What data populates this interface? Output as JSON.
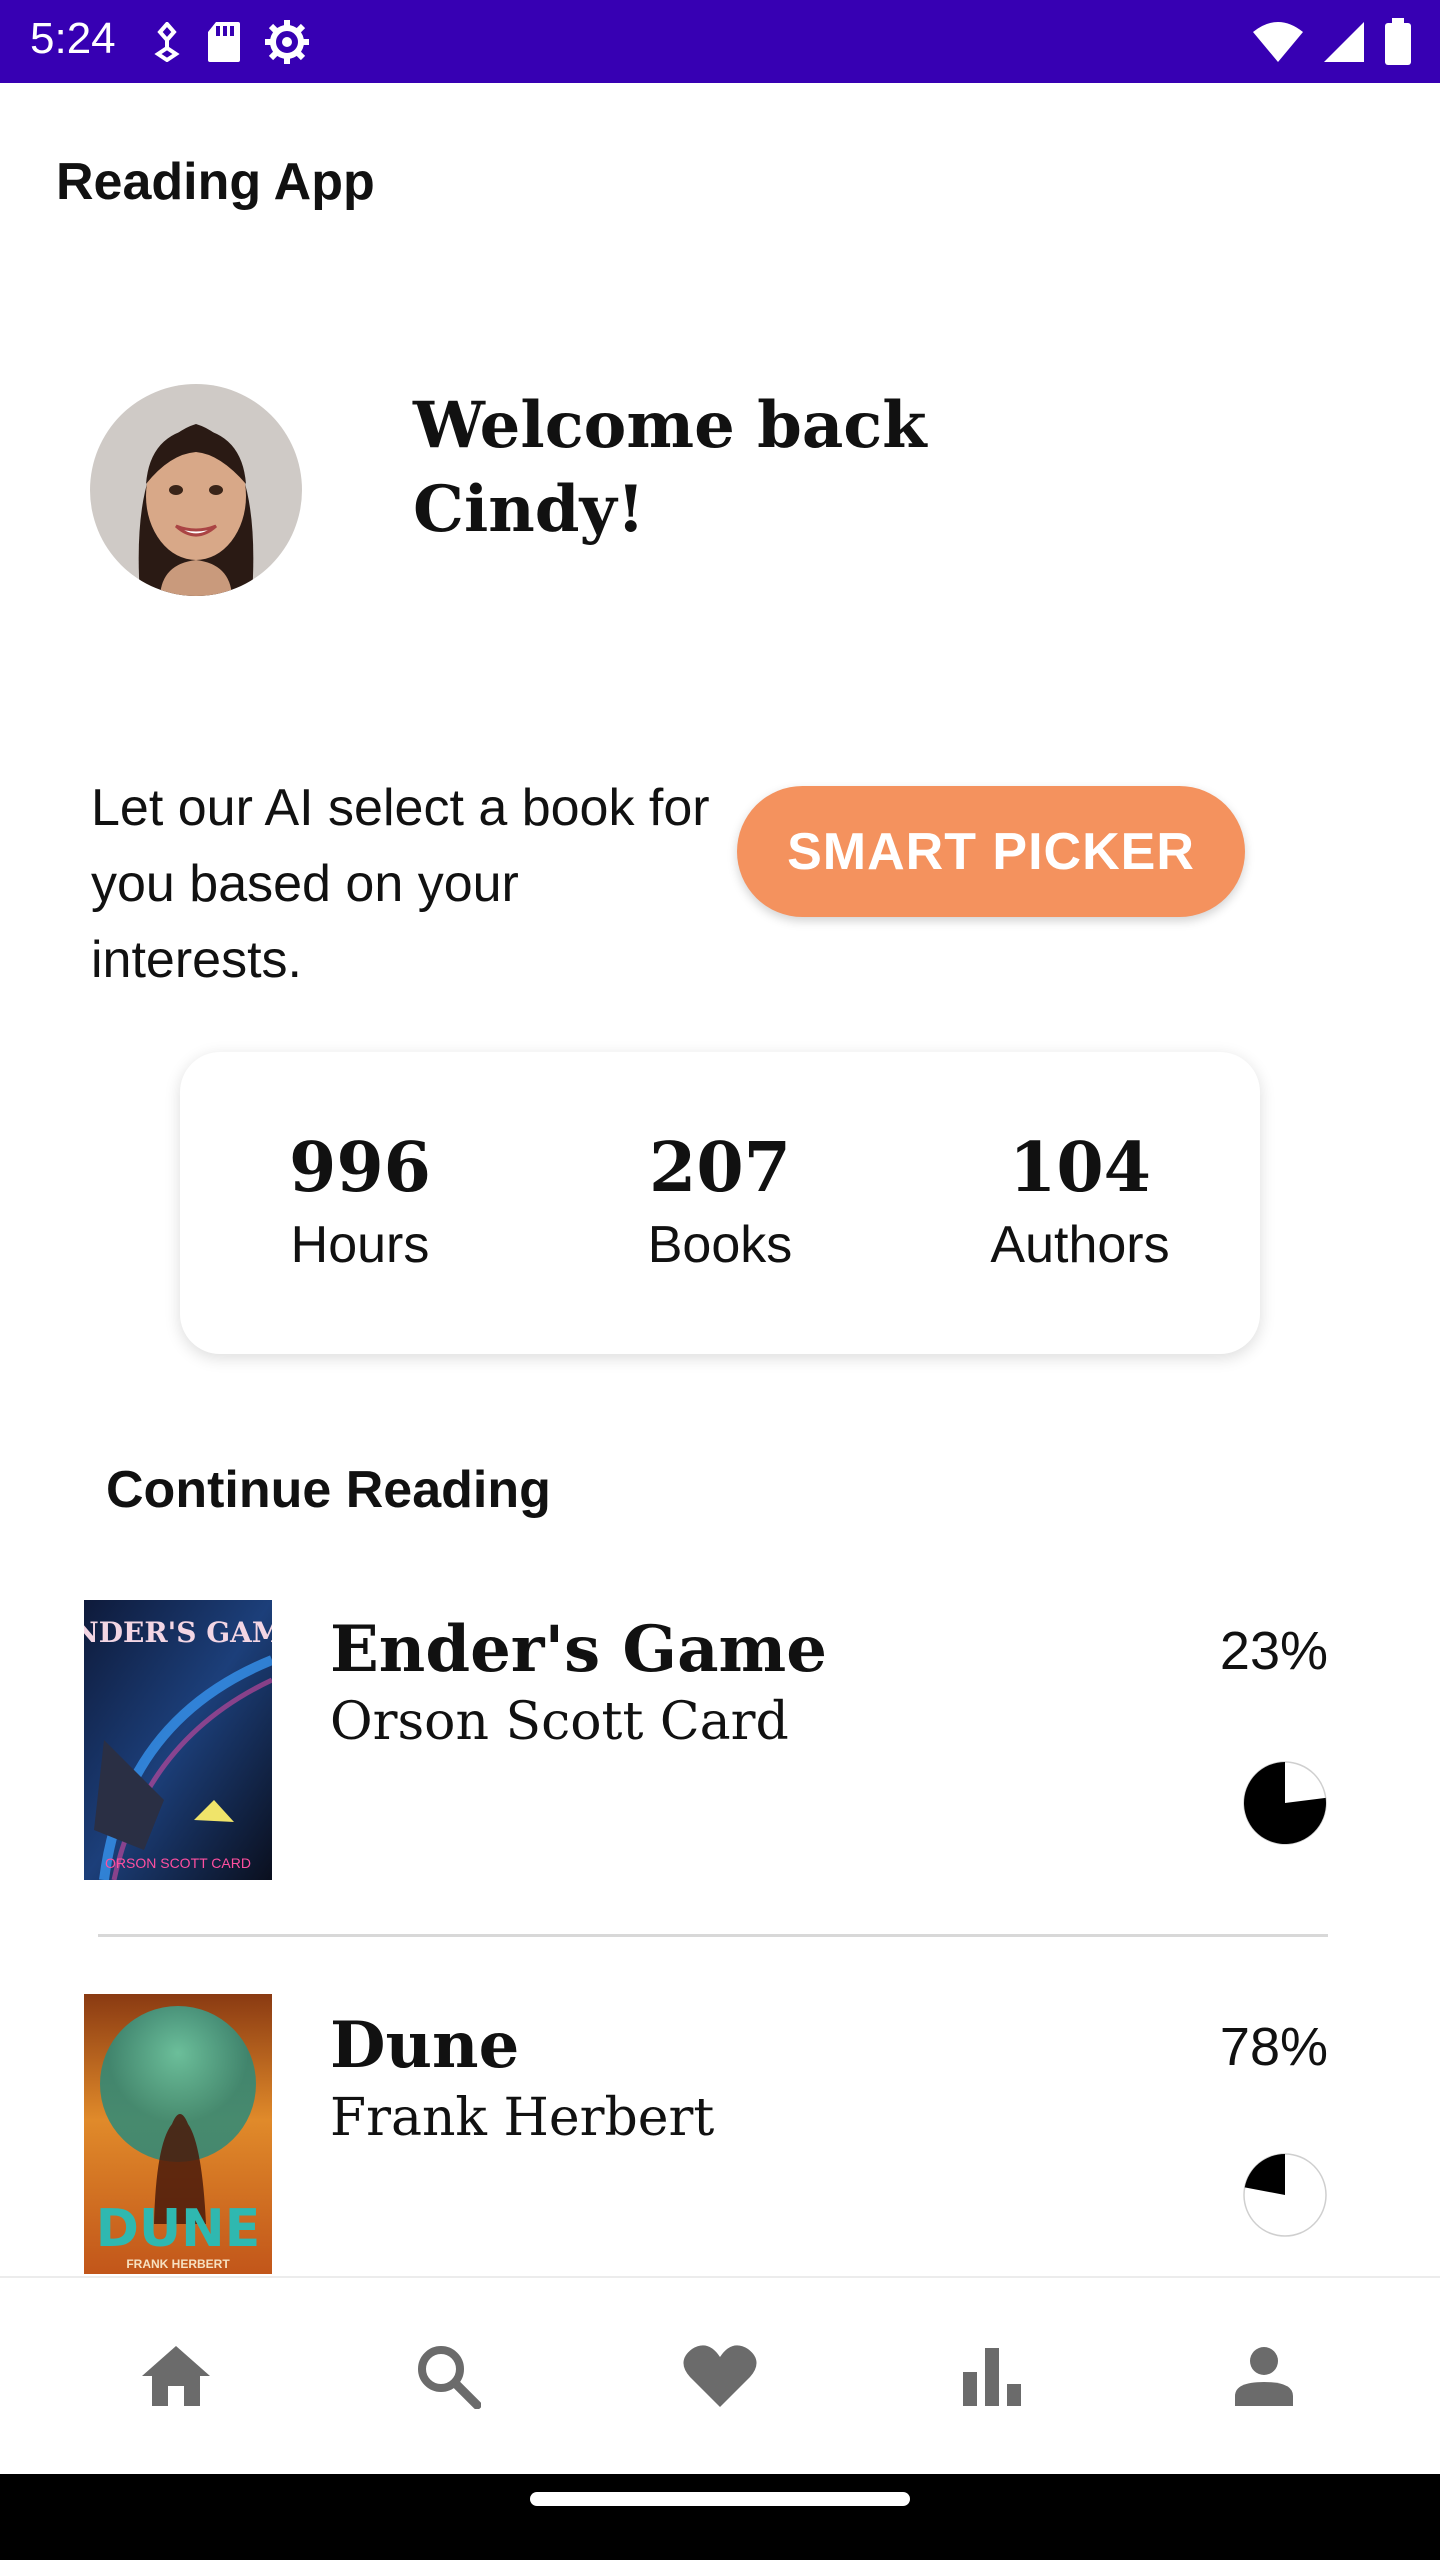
{
  "status_bar": {
    "time": "5:24",
    "left_icons": [
      "usb-debug-icon",
      "sd-card-icon",
      "settings-gear-icon"
    ],
    "right_icons": [
      "wifi-icon",
      "signal-icon",
      "battery-icon"
    ],
    "background": "#3700b3"
  },
  "app_bar": {
    "title": "Reading App"
  },
  "welcome": {
    "line1": "Welcome back",
    "line2": "Cindy!",
    "avatar": "user-avatar-photo"
  },
  "smart_picker": {
    "description": "Let our AI select a book for you based on your interests.",
    "button_label": "SMART PICKER",
    "button_color": "#f4925e"
  },
  "stats": [
    {
      "value": "996",
      "label": "Hours"
    },
    {
      "value": "207",
      "label": "Books"
    },
    {
      "value": "104",
      "label": "Authors"
    }
  ],
  "continue_reading": {
    "title": "Continue Reading",
    "books": [
      {
        "title": "Ender's Game",
        "author": "Orson Scott Card",
        "progress_text": "23%",
        "progress": 0.23,
        "cover_text": "ENDER'S GAME",
        "cover_author": "ORSON SCOTT CARD"
      },
      {
        "title": "Dune",
        "author": "Frank Herbert",
        "progress_text": "78%",
        "progress": 0.78,
        "cover_text": "DUNE",
        "cover_author": "FRANK HERBERT"
      }
    ]
  },
  "bottom_nav": {
    "items": [
      "home-icon",
      "search-icon",
      "favorites-heart-icon",
      "stats-bar-chart-icon",
      "profile-person-icon"
    ],
    "icon_color": "#6b6b6b"
  }
}
